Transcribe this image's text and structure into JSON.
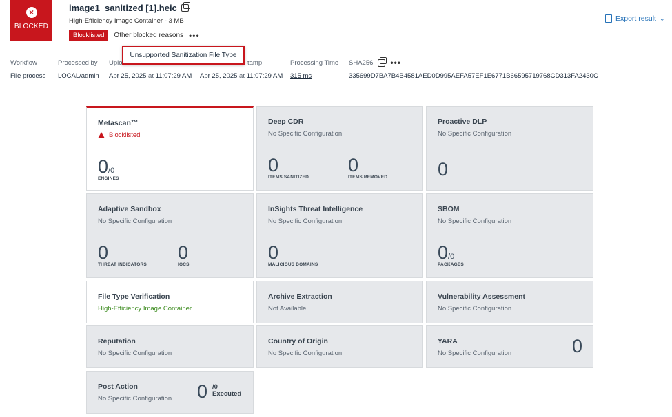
{
  "header": {
    "status": "BLOCKED",
    "filename": "image1_sanitized [1].heic",
    "file_info": "High-Efficiency Image Container - 3 MB",
    "badge": "Blocklisted",
    "other_reasons": "Other blocked reasons",
    "more": "•••",
    "tooltip": "Unsupported Sanitization File Type",
    "export": "Export result",
    "export_chevron": "⌄"
  },
  "meta": {
    "workflow_label": "Workflow",
    "workflow_value": "File process",
    "processed_by_label": "Processed by",
    "processed_by_value": "LOCAL/admin",
    "upload_label": "Uplo",
    "upload_date": "Apr 25, 2025",
    "upload_at": "at",
    "upload_time": "11:07:29 AM",
    "timestamp_label": "tamp",
    "timestamp_date": "Apr 25, 2025",
    "timestamp_at": "at",
    "timestamp_time": "11:07:29 AM",
    "processing_time_label": "Processing Time",
    "processing_time_value": "315 ms",
    "sha_label": "SHA256",
    "sha_more": "•••",
    "sha_value": "335699D7BA7B4B4581AED0D995AEFA57EF1E6771B66595719768CD313FA2430C"
  },
  "cards": {
    "metascan": {
      "title": "Metascan™",
      "status": "Blocklisted",
      "value": "0",
      "denominator": "/0",
      "caption": "ENGINES"
    },
    "deep_cdr": {
      "title": "Deep CDR",
      "sub": "No Specific Configuration",
      "value1": "0",
      "caption1": "ITEMS SANITIZED",
      "value2": "0",
      "caption2": "ITEMS REMOVED"
    },
    "proactive_dlp": {
      "title": "Proactive DLP",
      "sub": "No Specific Configuration",
      "value": "0"
    },
    "adaptive_sandbox": {
      "title": "Adaptive Sandbox",
      "sub": "No Specific Configuration",
      "value1": "0",
      "caption1": "THREAT INDICATORS",
      "value2": "0",
      "caption2": "IOCS"
    },
    "insights": {
      "title": "InSights Threat Intelligence",
      "sub": "No Specific Configuration",
      "value": "0",
      "caption": "MALICIOUS DOMAINS"
    },
    "sbom": {
      "title": "SBOM",
      "sub": "No Specific Configuration",
      "value": "0",
      "denominator": "/0",
      "caption": "PACKAGES"
    },
    "file_type": {
      "title": "File Type Verification",
      "sub": "High-Efficiency Image Container"
    },
    "archive": {
      "title": "Archive Extraction",
      "sub": "Not Available"
    },
    "vulnerability": {
      "title": "Vulnerability Assessment",
      "sub": "No Specific Configuration"
    },
    "reputation": {
      "title": "Reputation",
      "sub": "No Specific Configuration"
    },
    "country": {
      "title": "Country of Origin",
      "sub": "No Specific Configuration"
    },
    "yara": {
      "title": "YARA",
      "sub": "No Specific Configuration",
      "value": "0"
    },
    "post_action": {
      "title": "Post Action",
      "sub": "No Specific Configuration",
      "value": "0",
      "denominator": "/0",
      "caption": "Executed"
    }
  },
  "colors": {
    "blocked_red": "#c8161d",
    "link_blue": "#2672b8",
    "card_gray": "#e6e8eb",
    "success_green": "#3a8a1c"
  }
}
